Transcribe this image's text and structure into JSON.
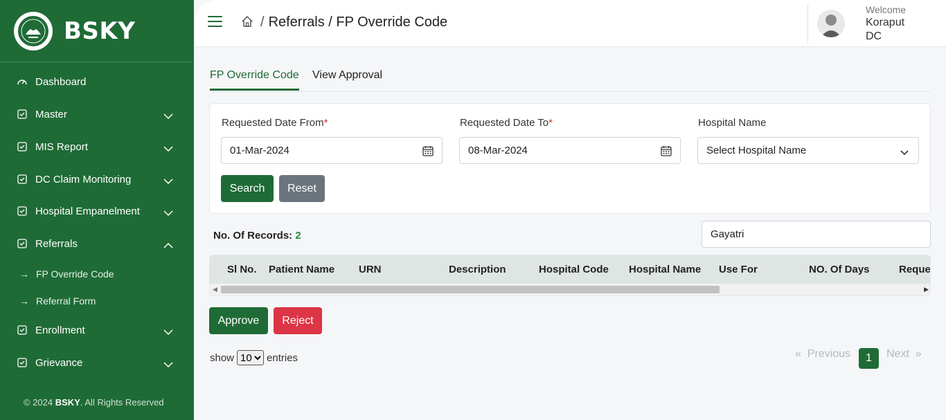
{
  "brand": {
    "name": "BSKY"
  },
  "sidebar": {
    "items": [
      {
        "label": "Dashboard",
        "icon": "gauge-icon"
      },
      {
        "label": "Master",
        "icon": "checkbox-icon"
      },
      {
        "label": "MIS Report",
        "icon": "checkbox-icon"
      },
      {
        "label": "DC Claim Monitoring",
        "icon": "checkbox-icon"
      },
      {
        "label": "Hospital Empanelment",
        "icon": "checkbox-icon"
      },
      {
        "label": "Referrals",
        "icon": "checkbox-icon"
      },
      {
        "label": "Enrollment",
        "icon": "checkbox-icon"
      },
      {
        "label": "Grievance",
        "icon": "checkbox-icon"
      }
    ],
    "subitems": [
      {
        "label": "FP Override Code"
      },
      {
        "label": "Referral Form"
      }
    ],
    "footer": {
      "prefix": "© 2024",
      "brand": "BSKY",
      "suffix": ". All Rights Reserved"
    }
  },
  "header": {
    "breadcrumb": "Referrals / FP Override Code",
    "welcome": "Welcome",
    "user": "Koraput DC"
  },
  "tabs": [
    {
      "label": "FP Override Code",
      "active": true
    },
    {
      "label": "View Approval",
      "active": false
    }
  ],
  "filters": {
    "date_from_label": "Requested Date From",
    "date_from_value": "01-Mar-2024",
    "date_to_label": "Requested Date To",
    "date_to_value": "08-Mar-2024",
    "hospital_label": "Hospital Name",
    "hospital_value": "Select Hospital Name",
    "required_mark": "*",
    "search_label": "Search",
    "reset_label": "Reset"
  },
  "records": {
    "label": "No. Of Records:",
    "count": "2"
  },
  "search": {
    "value": "Gayatri"
  },
  "table": {
    "columns": [
      "Sl No.",
      "Patient Name",
      "URN",
      "Description",
      "Hospital Code",
      "Hospital Name",
      "Use For",
      "NO. Of Days",
      "Reque"
    ]
  },
  "actions": {
    "approve_label": "Approve",
    "reject_label": "Reject"
  },
  "pagination": {
    "show_label": "show",
    "entries_label": "entries",
    "page_size": "10",
    "prev_label": "Previous",
    "next_label": "Next",
    "current_page": "1",
    "prev_arrow": "«",
    "next_arrow": "»"
  },
  "colors": {
    "primary": "#1f6b36",
    "danger": "#dc3545",
    "secondary": "#6c757d"
  }
}
